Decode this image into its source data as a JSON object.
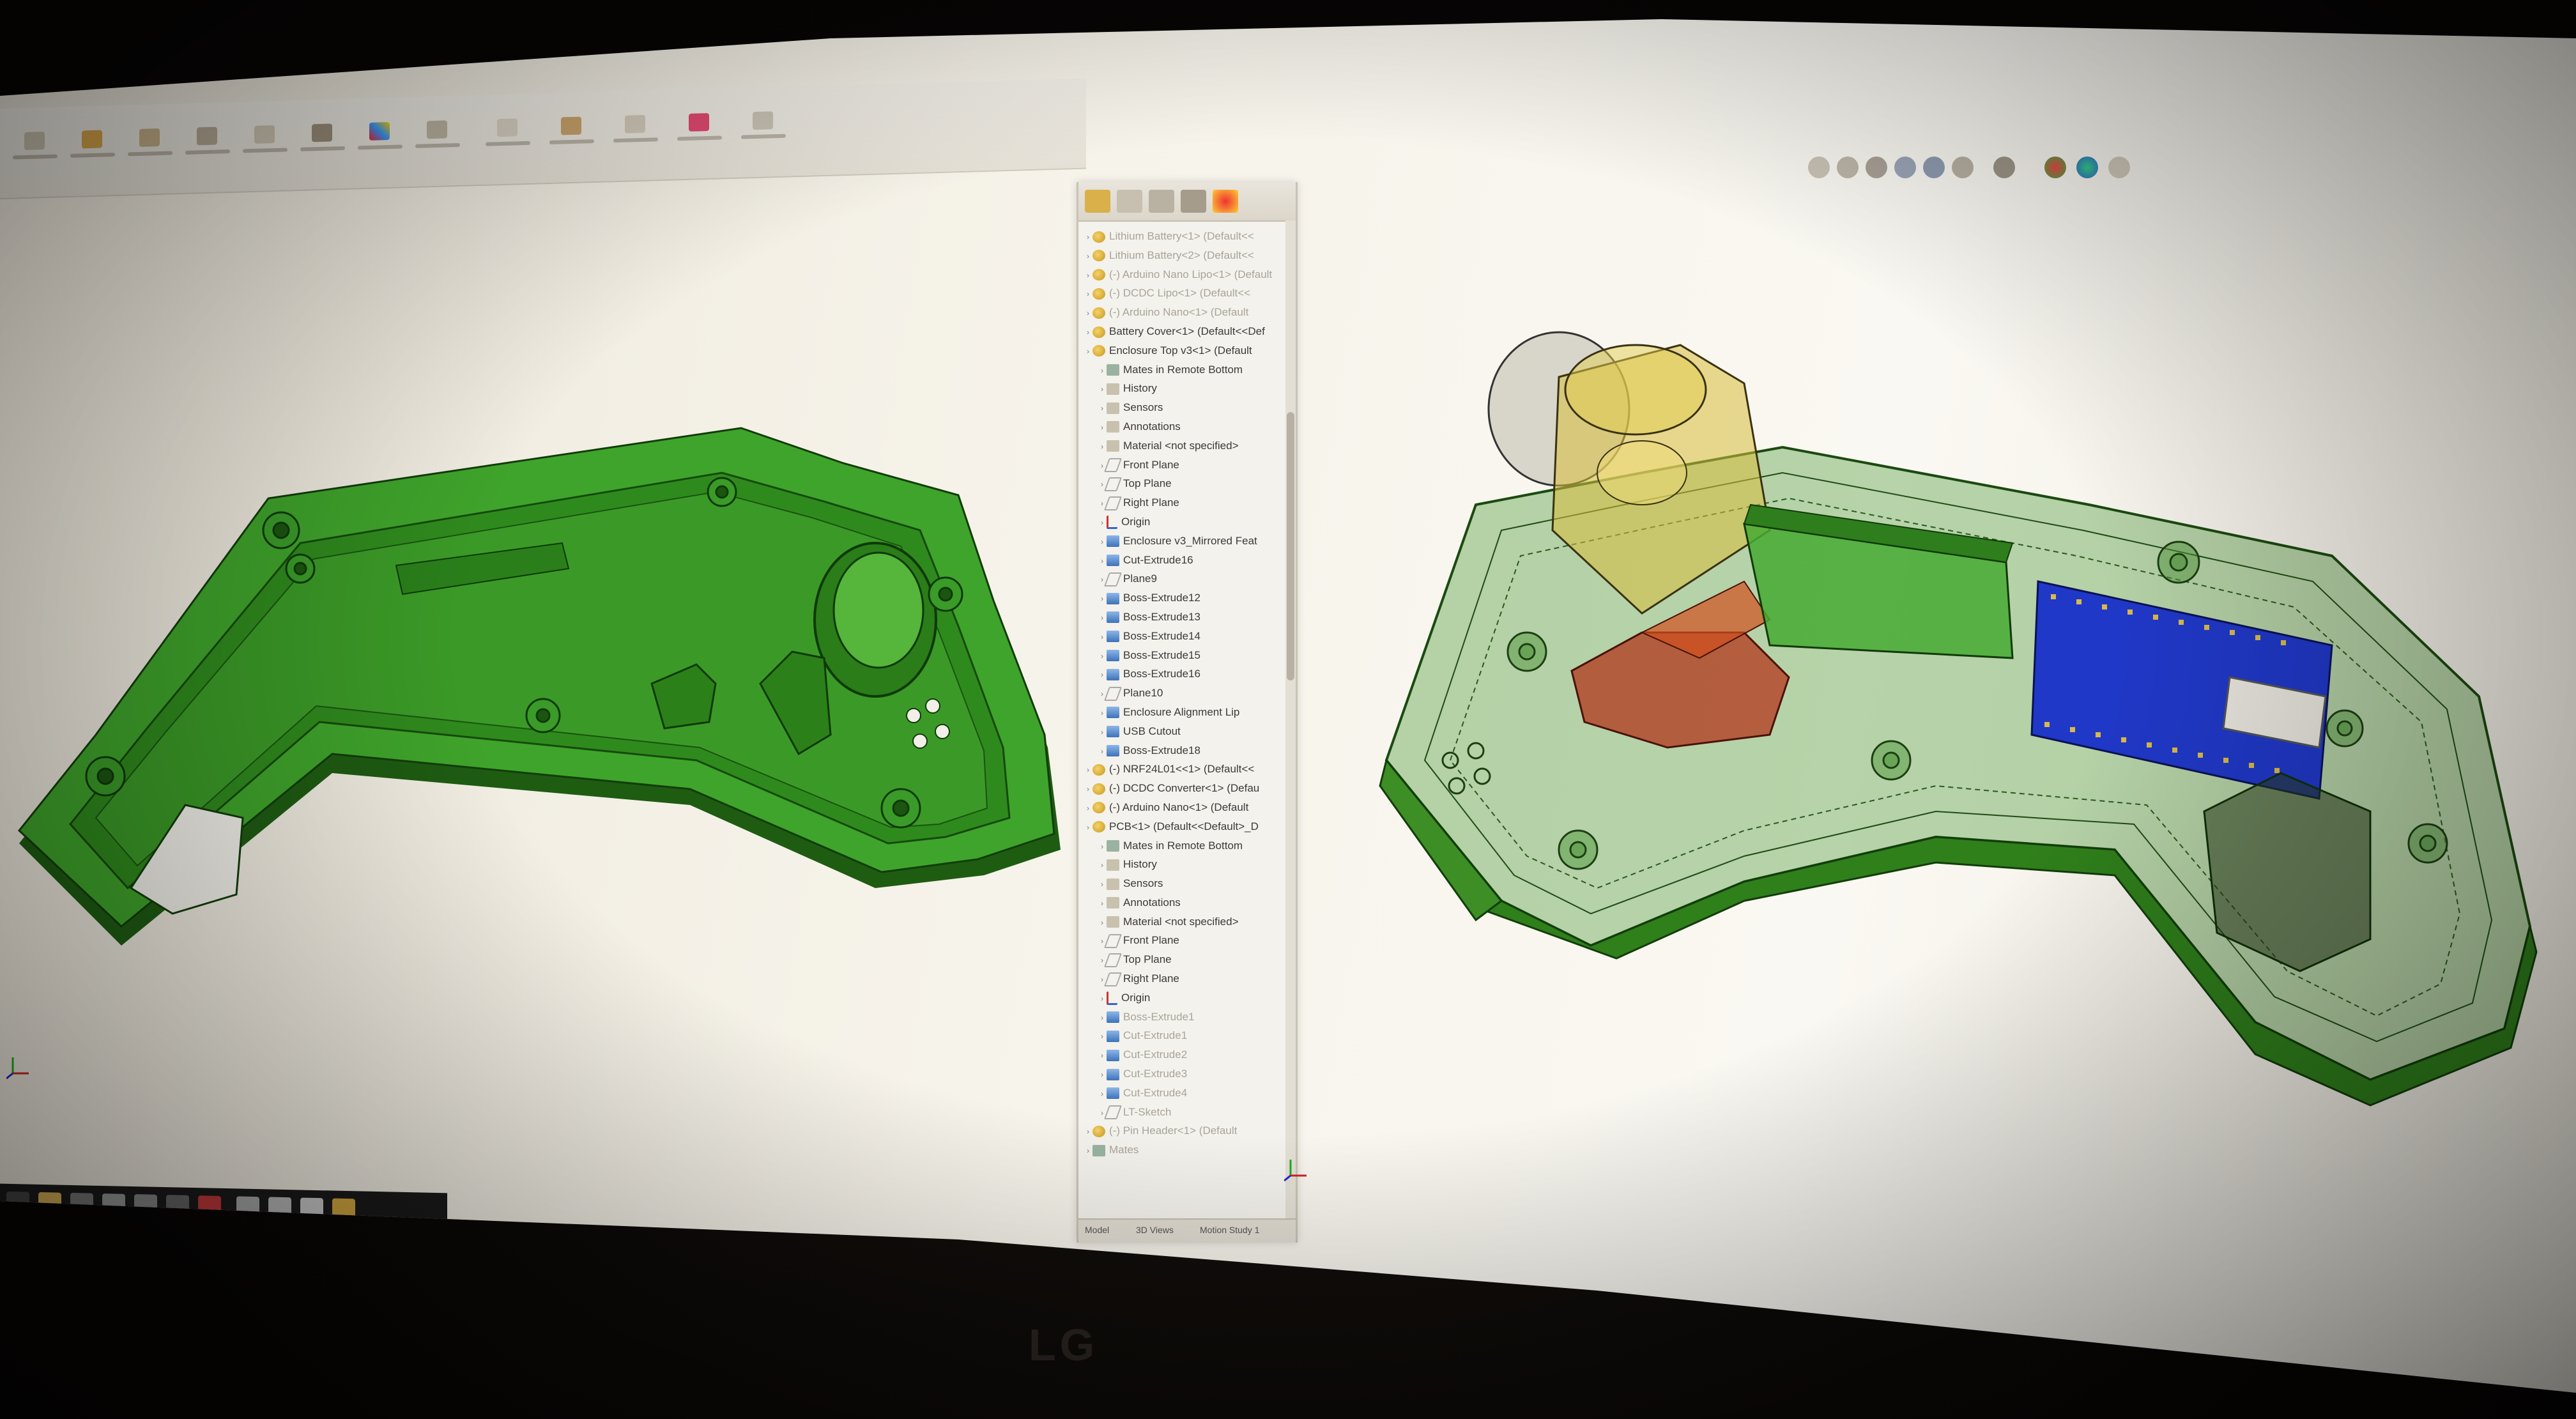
{
  "brand": "LG",
  "feature_tree": [
    {
      "label": "Lithium Battery<1> (Default<<",
      "icon": "part-icon",
      "indent": 0,
      "dim": true
    },
    {
      "label": "Lithium Battery<2> (Default<<",
      "icon": "part-icon",
      "indent": 0,
      "dim": true
    },
    {
      "label": "(-) Arduino Nano Lipo<1> (Default",
      "icon": "part-icon",
      "indent": 0,
      "dim": true
    },
    {
      "label": "(-) DCDC Lipo<1> (Default<<",
      "icon": "part-icon",
      "indent": 0,
      "dim": true
    },
    {
      "label": "(-) Arduino Nano<1> (Default",
      "icon": "part-icon",
      "indent": 0,
      "dim": true
    },
    {
      "label": "Battery Cover<1> (Default<<Def",
      "icon": "part-icon",
      "indent": 0,
      "dim": false
    },
    {
      "label": "Enclosure Top v3<1> (Default",
      "icon": "part-icon",
      "indent": 0,
      "dim": false
    },
    {
      "label": "Mates in Remote Bottom",
      "icon": "mate-icon",
      "indent": 1,
      "dim": false
    },
    {
      "label": "History",
      "icon": "folder-icon",
      "indent": 1,
      "dim": false
    },
    {
      "label": "Sensors",
      "icon": "folder-icon",
      "indent": 1,
      "dim": false
    },
    {
      "label": "Annotations",
      "icon": "folder-icon",
      "indent": 1,
      "dim": false
    },
    {
      "label": "Material <not specified>",
      "icon": "material-icon",
      "indent": 1,
      "dim": false
    },
    {
      "label": "Front Plane",
      "icon": "plane-icon",
      "indent": 1,
      "dim": false
    },
    {
      "label": "Top Plane",
      "icon": "plane-icon",
      "indent": 1,
      "dim": false
    },
    {
      "label": "Right Plane",
      "icon": "plane-icon",
      "indent": 1,
      "dim": false
    },
    {
      "label": "Origin",
      "icon": "origin-icon",
      "indent": 1,
      "dim": false
    },
    {
      "label": "Enclosure v3_Mirrored Feat",
      "icon": "feature-icon",
      "indent": 1,
      "dim": false
    },
    {
      "label": "Cut-Extrude16",
      "icon": "feature-icon",
      "indent": 1,
      "dim": false
    },
    {
      "label": "Plane9",
      "icon": "plane-icon",
      "indent": 1,
      "dim": false
    },
    {
      "label": "Boss-Extrude12",
      "icon": "feature-icon",
      "indent": 1,
      "dim": false
    },
    {
      "label": "Boss-Extrude13",
      "icon": "feature-icon",
      "indent": 1,
      "dim": false
    },
    {
      "label": "Boss-Extrude14",
      "icon": "feature-icon",
      "indent": 1,
      "dim": false
    },
    {
      "label": "Boss-Extrude15",
      "icon": "feature-icon",
      "indent": 1,
      "dim": false
    },
    {
      "label": "Boss-Extrude16",
      "icon": "feature-icon",
      "indent": 1,
      "dim": false
    },
    {
      "label": "Plane10",
      "icon": "plane-icon",
      "indent": 1,
      "dim": false
    },
    {
      "label": "Enclosure Alignment Lip",
      "icon": "feature-icon",
      "indent": 1,
      "dim": false
    },
    {
      "label": "USB Cutout",
      "icon": "feature-icon",
      "indent": 1,
      "dim": false
    },
    {
      "label": "Boss-Extrude18",
      "icon": "feature-icon",
      "indent": 1,
      "dim": false
    },
    {
      "label": "(-) NRF24L01<<1> (Default<<",
      "icon": "part-icon",
      "indent": 0,
      "dim": false
    },
    {
      "label": "(-) DCDC Converter<1> (Defau",
      "icon": "part-icon",
      "indent": 0,
      "dim": false
    },
    {
      "label": "(-) Arduino Nano<1> (Default",
      "icon": "part-icon",
      "indent": 0,
      "dim": false
    },
    {
      "label": "PCB<1> (Default<<Default>_D",
      "icon": "part-icon",
      "indent": 0,
      "dim": false
    },
    {
      "label": "Mates in Remote Bottom",
      "icon": "mate-icon",
      "indent": 1,
      "dim": false
    },
    {
      "label": "History",
      "icon": "folder-icon",
      "indent": 1,
      "dim": false
    },
    {
      "label": "Sensors",
      "icon": "folder-icon",
      "indent": 1,
      "dim": false
    },
    {
      "label": "Annotations",
      "icon": "folder-icon",
      "indent": 1,
      "dim": false
    },
    {
      "label": "Material <not specified>",
      "icon": "material-icon",
      "indent": 1,
      "dim": false
    },
    {
      "label": "Front Plane",
      "icon": "plane-icon",
      "indent": 1,
      "dim": false
    },
    {
      "label": "Top Plane",
      "icon": "plane-icon",
      "indent": 1,
      "dim": false
    },
    {
      "label": "Right Plane",
      "icon": "plane-icon",
      "indent": 1,
      "dim": false
    },
    {
      "label": "Origin",
      "icon": "origin-icon",
      "indent": 1,
      "dim": false
    },
    {
      "label": "Boss-Extrude1",
      "icon": "feature-icon",
      "indent": 1,
      "dim": true
    },
    {
      "label": "Cut-Extrude1",
      "icon": "feature-icon",
      "indent": 1,
      "dim": true
    },
    {
      "label": "Cut-Extrude2",
      "icon": "feature-icon",
      "indent": 1,
      "dim": true
    },
    {
      "label": "Cut-Extrude3",
      "icon": "feature-icon",
      "indent": 1,
      "dim": true
    },
    {
      "label": "Cut-Extrude4",
      "icon": "feature-icon",
      "indent": 1,
      "dim": true
    },
    {
      "label": "LT-Sketch",
      "icon": "sketch-icon",
      "indent": 1,
      "dim": true
    },
    {
      "label": "(-) Pin Header<1> (Default",
      "icon": "part-icon",
      "indent": 0,
      "dim": true
    },
    {
      "label": "Mates",
      "icon": "mate-icon",
      "indent": 0,
      "dim": true
    }
  ],
  "bottom_tabs": [
    "Model",
    "3D Views",
    "Motion Study 1"
  ],
  "colors": {
    "enclosure_green": "#3f9a2a",
    "enclosure_dark": "#1e5c12",
    "pcb_green": "#3f9f2f",
    "arduino_blue": "#2038c8",
    "battery_yellow": "#d7c23b",
    "battery_red": "#b3351c"
  }
}
